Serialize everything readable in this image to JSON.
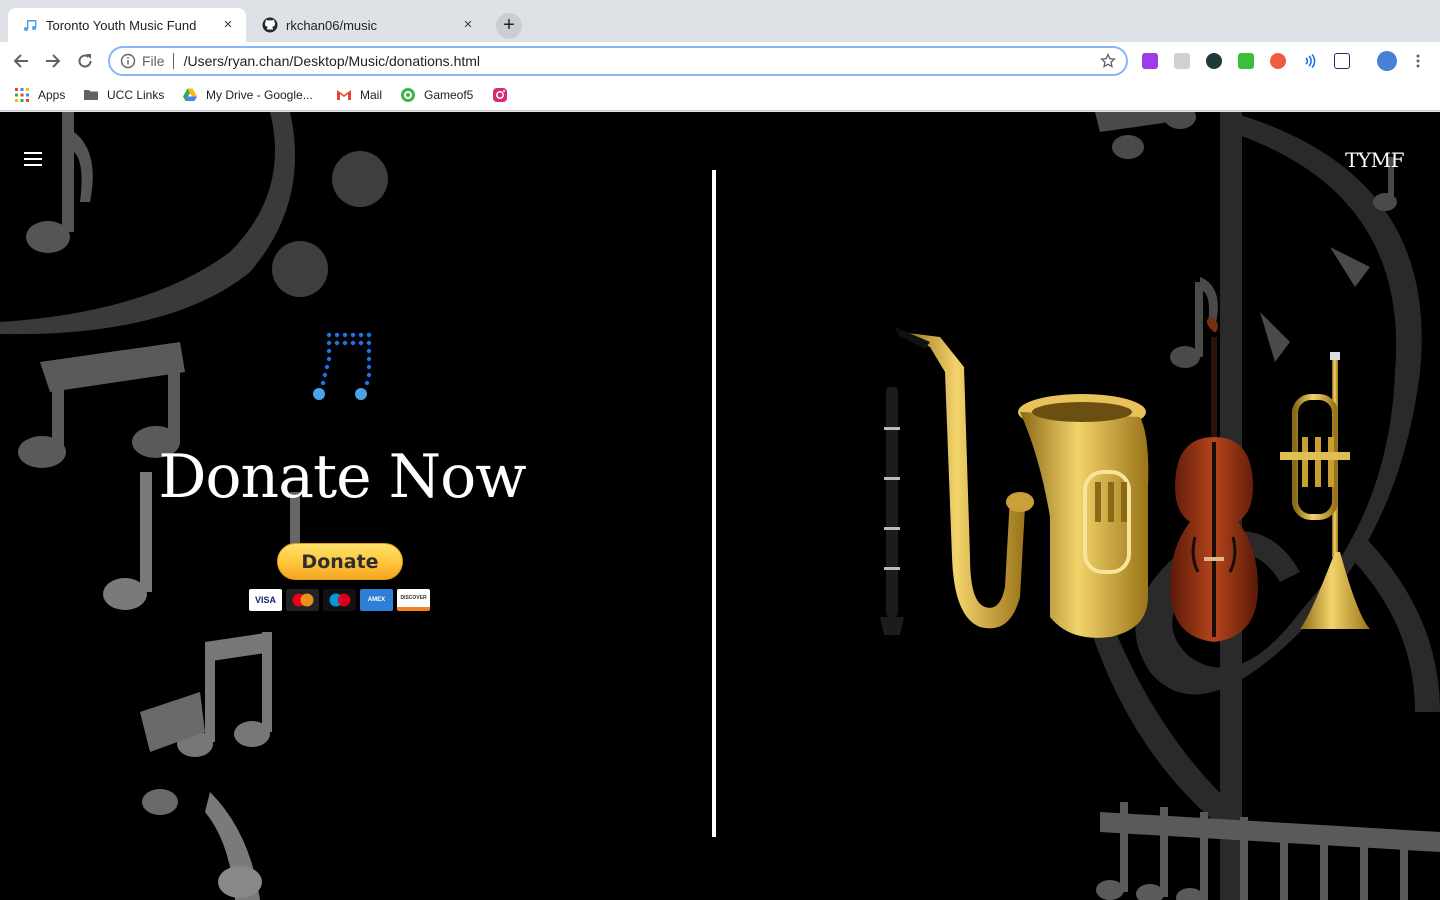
{
  "tabs": [
    {
      "title": "Toronto Youth Music Fund",
      "close": "×"
    },
    {
      "title": "rkchan06/music",
      "close": "×"
    }
  ],
  "newtab": "+",
  "omnibox": {
    "scheme": "File",
    "url": "/Users/ryan.chan/Desktop/Music/donations.html"
  },
  "bookmarks": [
    {
      "label": "Apps"
    },
    {
      "label": "UCC Links"
    },
    {
      "label": "My Drive - Google..."
    },
    {
      "label": "Mail"
    },
    {
      "label": "Gameof5"
    }
  ],
  "page": {
    "brand": "TYMF",
    "headline": "Donate Now",
    "donate_label": "Donate",
    "cards": [
      "VISA",
      "MC",
      "MAESTRO",
      "AMEX",
      "DISCOVER"
    ]
  },
  "colors": {
    "accent": "#1a73e8",
    "paypal": "#ffc439",
    "logo_blue": "#4da3e8"
  }
}
